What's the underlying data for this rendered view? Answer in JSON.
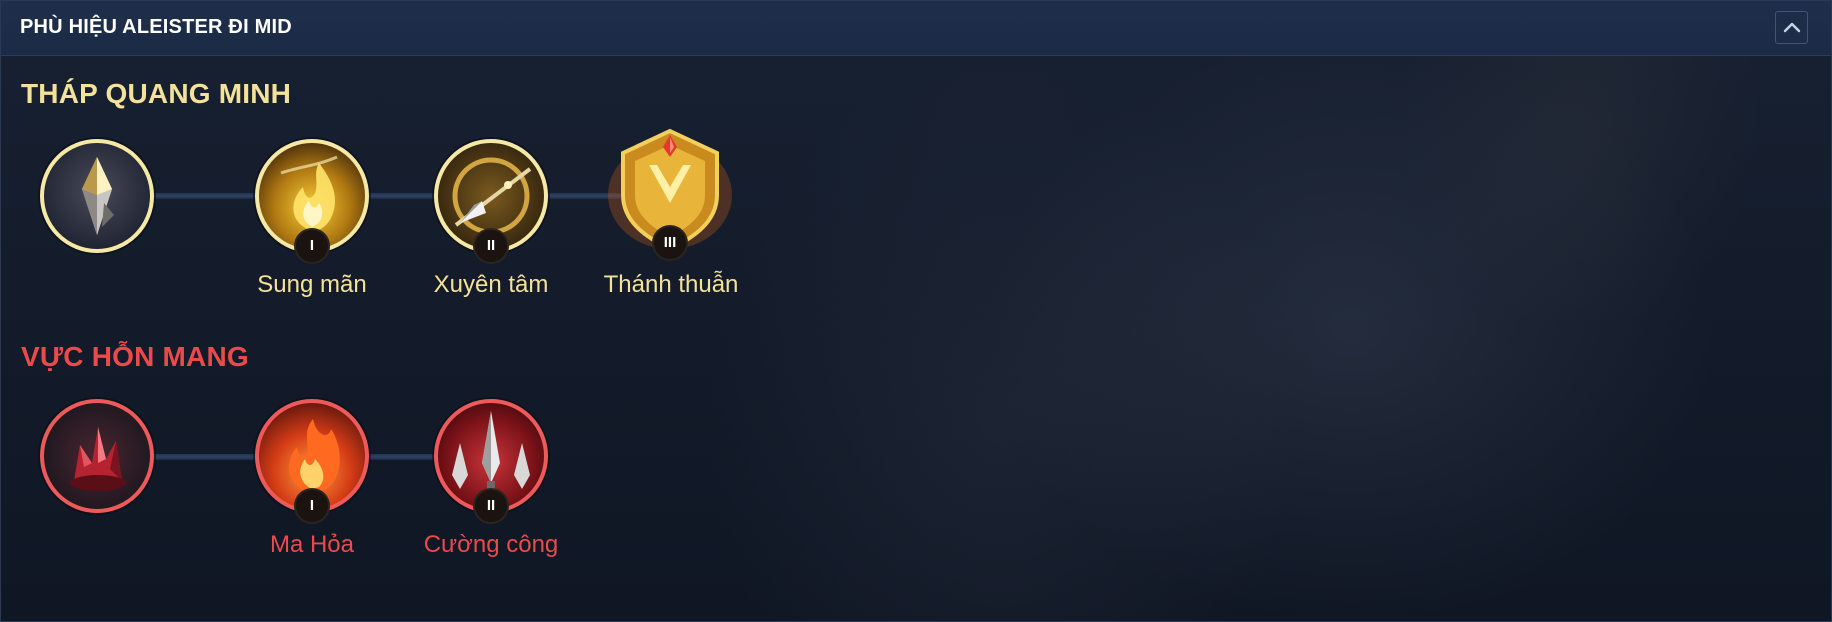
{
  "header": {
    "title": "PHÙ HIỆU ALEISTER ĐI MID",
    "collapse_icon": "chevron-up-icon"
  },
  "sections": [
    {
      "title": "THÁP QUANG MINH",
      "color": "#f4e29a",
      "emblem_icon": "gold-crystal-icon",
      "runes": [
        {
          "label": "Sung mãn",
          "tier": "I",
          "icon": "golden-flame-icon"
        },
        {
          "label": "Xuyên tâm",
          "tier": "II",
          "icon": "piercing-spear-icon"
        },
        {
          "label": "Thánh thuẫn",
          "tier": "III",
          "icon": "holy-shield-icon"
        }
      ]
    },
    {
      "title": "VỰC HỖN MANG",
      "color": "#ea4a4a",
      "emblem_icon": "red-crystal-icon",
      "runes": [
        {
          "label": "Ma Hỏa",
          "tier": "I",
          "icon": "demon-fire-icon"
        },
        {
          "label": "Cường công",
          "tier": "II",
          "icon": "triple-spike-icon"
        }
      ]
    }
  ]
}
